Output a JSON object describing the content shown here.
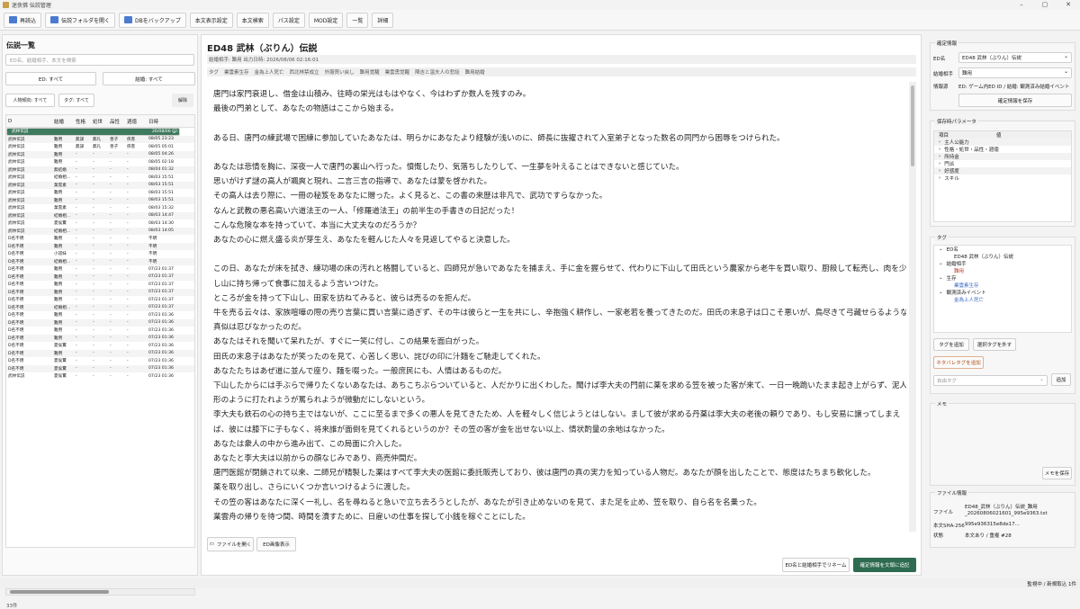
{
  "window": {
    "title": "迷侠佛 伝説管理"
  },
  "toolbar": [
    {
      "label": "再読込",
      "icon": "refresh-icon",
      "color": "#4a7bd0"
    },
    {
      "label": "伝説フォルダを開く",
      "icon": "folder-icon",
      "color": "#4a7bd0"
    },
    {
      "label": "DBをバックアップ",
      "icon": "database-icon",
      "color": "#4a7bd0"
    },
    {
      "label": "本文表示設定"
    },
    {
      "label": "本文検索"
    },
    {
      "label": "パス設定"
    },
    {
      "label": "MOD設定"
    },
    {
      "label": "一覧"
    },
    {
      "label": "詳細"
    }
  ],
  "left": {
    "title": "伝説一覧",
    "search_placeholder": "ED名、結婚相手、本文を検索",
    "filter_ed": "ED: すべて",
    "filter_marriage": "結婚: すべて",
    "filter_person": "人物傾向: すべて",
    "filter_tag": "タグ: すべて",
    "clear": "解除",
    "headers": [
      "D",
      "結婚",
      "性格",
      "処世",
      "品性",
      "週徳",
      "日時"
    ],
    "rows": [
      [
        "武林伝説",
        "",
        "",
        "",
        "",
        "",
        "26/08/06 02:16"
      ],
      [
        "武林伝説",
        "難用",
        "無謀",
        "無礼",
        "善子",
        "侠客",
        "08/06 00:18"
      ],
      [
        "武林伝説",
        "難用",
        "無謀",
        "無礼",
        "善子",
        "侠客",
        "08/05 23:23"
      ],
      [
        "武林伝説",
        "難用",
        "無謀",
        "無礼",
        "善子",
        "侠客",
        "08/05 05:01"
      ],
      [
        "武林伝説",
        "難用",
        "-",
        "-",
        "-",
        "-",
        "08/05 04:26"
      ],
      [
        "武林伝説",
        "難用",
        "-",
        "-",
        "-",
        "-",
        "08/05 02:18"
      ],
      [
        "武林伝説",
        "無結婚",
        "-",
        "-",
        "-",
        "-",
        "08/04 01:32"
      ],
      [
        "武林伝説",
        "結婚相...",
        "-",
        "-",
        "-",
        "-",
        "08/03 15:51"
      ],
      [
        "武林伝説",
        "業雲素",
        "-",
        "-",
        "-",
        "-",
        "08/03 15:51"
      ],
      [
        "武林伝説",
        "難用",
        "-",
        "-",
        "-",
        "-",
        "08/03 15:51"
      ],
      [
        "武林伝説",
        "難用",
        "-",
        "-",
        "-",
        "-",
        "08/03 15:51"
      ],
      [
        "武林伝説",
        "業雲素",
        "-",
        "-",
        "-",
        "-",
        "08/03 15:32"
      ],
      [
        "武林伝説",
        "結婚相...",
        "-",
        "-",
        "-",
        "-",
        "08/03 14:47"
      ],
      [
        "武林伝説",
        "夏侯驚",
        "-",
        "-",
        "-",
        "-",
        "08/03 14:30"
      ],
      [
        "武林伝説",
        "結婚相...",
        "-",
        "-",
        "-",
        "-",
        "08/03 14:05"
      ],
      [
        "D名不明",
        "難用",
        "-",
        "-",
        "-",
        "-",
        "不明"
      ],
      [
        "D名不明",
        "難用",
        "-",
        "-",
        "-",
        "-",
        "不明"
      ],
      [
        "D名不明",
        "小諾妹",
        "-",
        "-",
        "-",
        "-",
        "不明"
      ],
      [
        "D名不明",
        "結婚相...",
        "-",
        "-",
        "-",
        "-",
        "不明"
      ],
      [
        "D名不明",
        "難用",
        "-",
        "-",
        "-",
        "-",
        "07/23 01:37"
      ],
      [
        "D名不明",
        "難用",
        "-",
        "-",
        "-",
        "-",
        "07/23 01:37"
      ],
      [
        "D名不明",
        "難用",
        "-",
        "-",
        "-",
        "-",
        "07/23 01:37"
      ],
      [
        "D名不明",
        "難用",
        "-",
        "-",
        "-",
        "-",
        "07/23 01:37"
      ],
      [
        "D名不明",
        "難用",
        "-",
        "-",
        "-",
        "-",
        "07/23 01:37"
      ],
      [
        "D名不明",
        "結婚相...",
        "-",
        "-",
        "-",
        "-",
        "07/23 01:37"
      ],
      [
        "D名不明",
        "難用",
        "-",
        "-",
        "-",
        "-",
        "07/23 01:36"
      ],
      [
        "D名不明",
        "難用",
        "-",
        "-",
        "-",
        "-",
        "07/23 01:36"
      ],
      [
        "D名不明",
        "難用",
        "-",
        "-",
        "-",
        "-",
        "07/23 01:36"
      ],
      [
        "D名不明",
        "難用",
        "-",
        "-",
        "-",
        "-",
        "07/23 01:36"
      ],
      [
        "D名不明",
        "夏侯驚",
        "-",
        "-",
        "-",
        "-",
        "07/23 01:36"
      ],
      [
        "D名不明",
        "難用",
        "-",
        "-",
        "-",
        "-",
        "07/23 01:36"
      ],
      [
        "D名不明",
        "夏侯驚",
        "-",
        "-",
        "-",
        "-",
        "07/23 01:36"
      ],
      [
        "D名不明",
        "夏侯驚",
        "-",
        "-",
        "-",
        "-",
        "07/23 01:36"
      ],
      [
        "武林伝説",
        "夏侯驚",
        "-",
        "-",
        "-",
        "-",
        "07/23 01:36"
      ]
    ],
    "count": "33件"
  },
  "center": {
    "title": "ED48 武林（ぶりん）伝説",
    "meta": "結婚相手: 難用  出力日時: 2026/08/06 02:16:01",
    "tag_label": "タグ",
    "tags": [
      "業雲素生存",
      "金為上人死亡",
      "西北林禁成立",
      "外服買い戻し",
      "難用覚醒",
      "業雲勇覚醒",
      "陣吉と温夫人の悲話",
      "難用結婚"
    ],
    "paragraphs": [
      "唐門は家門衰退し、借金は山積み、往時の栄光はもはやなく、今はわずか数人を残すのみ。",
      "最後の門弟として、あなたの物語はここから始まる。",
      "",
      "ある日、唐門の練武場で困練に参加していたあなたは、明らかにあなたより経験が浅いのに、師長に抜擢されて入室弟子となった数名の同門から困辱をつけられた。",
      "",
      "あなたは悲情を胸に、深夜一人で唐門の裏山へ行った。憤慨したり、気落ちしたりして、一生夢を叶えることはできないと感じていた。",
      "思いがけず謎の高人が颯爽と現れ、二言三言の指導で、あなたは蒙を啓かれた。",
      "その高人は去り際に、一冊の秘笈をあなたに贈った。よく見ると、この書の来歴は非凡で、武功ですらなかった。",
      "なんと武教の悪名高い六道法王の一人、「修羅道法王」の前半生の手書きの日記だった！",
      "こんな危険な本を持っていて、本当に大丈夫なのだろうか？",
      "あなたの心に燃え盛る炎が芽生え、あなたを軽んじた人々を見返してやると決意した。",
      "",
      "この日、あなたが床を拭き、練功場の床の汚れと格闘していると、四師兄が急いであなたを捕まえ、手に金を握らせて、代わりに下山して田氏という農家から老牛を買い取り、厨殺して転売し、肉を少",
      "し山に持ち帰って食事に加えるよう言いつけた。",
      "ところが金を持って下山し、田家を訪ねてみると、彼らは売るのを拒んだ。",
      "牛を売る云々は、家族喧嘩の際の売り言葉に買い言葉に過ぎず、その牛は彼らと一生を共にし、辛抱強く耕作し、一家老若を養ってきたのだ。田氏の末息子は口こそ悪いが、鳥尽きて弓藏せらるような",
      "真似は忍びなかったのだ。",
      "あなたはそれを聞いて呆れたが、すぐに一笑に付し、この結果を面白がった。",
      "田氏の末息子はあなたが笑ったのを見て、心苦しく思い、詫びの印に汁麺をご馳走してくれた。",
      "あなたたちはあぜ道に並んで座り、麺を啜った。一般庶民にも、人情はあるものだ。",
      "下山したからには手ぶらで帰りたくないあなたは、あちこちぶらついていると、人だかりに出くわした。聞けば李大夫の門前に薬を求める笠を被った客が来て、一日一晩跪いたまま起き上がらず、泥人",
      "形のように打たれようが罵られようが微動だにしないという。",
      "李大夫も鉄石の心の持ち主ではないが、ここに至るまで多くの悪人を見てきたため、人を軽々しく信じようとはしない。まして彼が求める丹薬は李大夫の老後の頼りであり、もし安易に譲ってしまえ",
      "ば、彼には膝下に子もなく、将来誰が面倒を見てくれるというのか？その笠の客が金を出せない以上、情状酌量の余地はなかった。",
      "あなたは衆人の中から進み出て、この局面に介入した。",
      "あなたと李大夫は以前からの顔なじみであり、商売仲間だ。",
      "唐門医館が閉鎖されて以来、二師兄が精製した薬はすべて李大夫の医館に委託販売しており、彼は唐門の真の実力を知っている人物だ。あなたが顔を出したことで、態度はたちまち軟化した。",
      "薬を取り出し、さらにいくつか言いつけるように渡した。",
      "その笠の客はあなたに深く一礼し、名を尋ねると急いで立ち去ろうとしたが、あなたが引き止めないのを見て、また足を止め、笠を取り、自ら名を名乗った。",
      "業雲舟の帰りを待つ間、時間を潰すために、日雇いの仕事を探して小銭を稼ぐことにした。"
    ],
    "open_file": "ファイルを開く",
    "ed_image": "ED画像表示",
    "rename": "ED名と結婚相手でリネーム",
    "append": "確定情報を文頭に追記"
  },
  "right": {
    "confirmed_title": "確定情報",
    "ed_label": "ED名",
    "ed_value": "ED48 武林（ぶりん）伝説",
    "partner_label": "結婚相手",
    "partner_value": "難用",
    "source_label": "情報源",
    "source_value": "ED: ゲーム内ED ID / 結婚: 観測済み結婚イベント",
    "save_confirmed": "確定情報を保存",
    "params_title": "保存時パラメータ",
    "params_headers": [
      "項目",
      "値"
    ],
    "params_items": [
      "主人公能力",
      "性格・処世・品性・週徳",
      "所持金",
      "門派",
      "好感度",
      "スキル"
    ],
    "tags_title": "タグ",
    "tag_tree": [
      {
        "label": "ED名",
        "children": [
          "ED48 武林（ぶりん）伝説"
        ]
      },
      {
        "label": "結婚相手",
        "children": [
          "難用"
        ]
      },
      {
        "label": "生存",
        "children": [
          "業雲素生存"
        ]
      },
      {
        "label": "観測済みイベント",
        "children": [
          "金為上人死亡"
        ]
      }
    ],
    "add_tag": "タグを追加",
    "remove_tag": "選択タグを外す",
    "add_spoiler": "ネタバレタグを追加",
    "free_tag_placeholder": "自由タグ",
    "add": "追加",
    "memo_title": "メモ",
    "save_memo": "メモを保存",
    "file_title": "ファイル情報",
    "file_label": "ファイル",
    "file_value": "ED48_武林（ぶりん）伝説_難用_20260806021601_995e9363.txt",
    "sha_label": "本文SHA-256",
    "sha_value": "995e936315e8de17...",
    "state_label": "状態",
    "state_value": "本文あり / 重複 #28"
  },
  "status": "監視中 / 新規取込 1件"
}
